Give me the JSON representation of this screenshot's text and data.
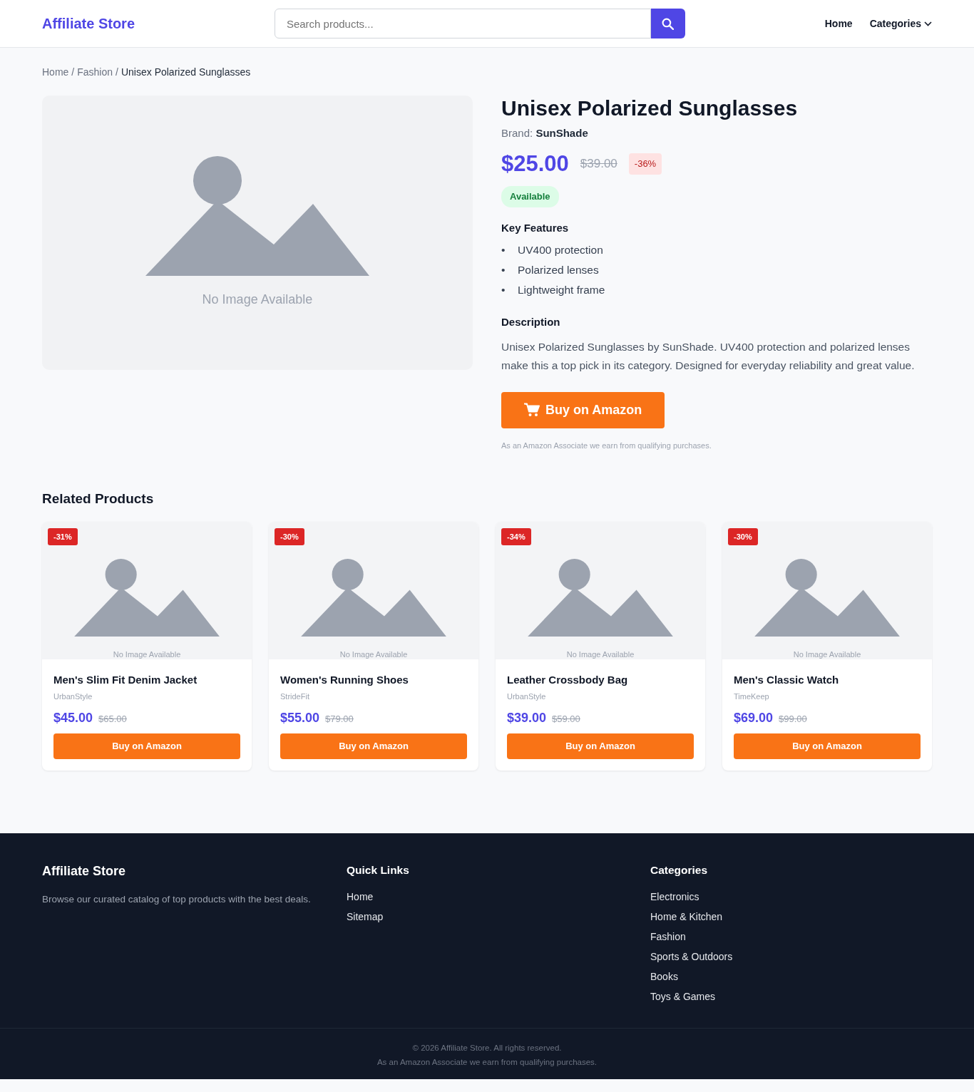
{
  "header": {
    "brand": "Affiliate Store",
    "search": {
      "placeholder": "Search products..."
    },
    "nav": [
      {
        "label": "Home",
        "kind": "link"
      },
      {
        "label": "Categories",
        "kind": "dropdown"
      }
    ]
  },
  "breadcrumb": {
    "separator": "/",
    "items": [
      "Home",
      "Fashion",
      "Unisex Polarized Sunglasses"
    ]
  },
  "product": {
    "image_caption": "No Image Available",
    "title": "Unisex Polarized Sunglasses",
    "brand_line": "Brand: **SunShade**",
    "price": "$25.00",
    "old_price": "$39.00",
    "discount": "-36%",
    "availability": "Available",
    "features_heading": "Key Features",
    "feature_bullet": "•",
    "features": [
      "UV400 protection",
      "Polarized lenses",
      "Lightweight frame"
    ],
    "description_heading": "Description",
    "description": "Unisex Polarized Sunglasses by SunShade. UV400 protection and polarized lenses make this a top pick in its category. Designed for everyday reliability and great value.",
    "buy_button": "Buy on Amazon",
    "disclosure": "As an Amazon Associate we earn from qualifying purchases."
  },
  "related": {
    "heading": "Related Products",
    "items": [
      {
        "discount": "-31%",
        "image_caption": "No Image Available",
        "name": "Men's Slim Fit Denim Jacket",
        "brand": "UrbanStyle",
        "price": "$45.00",
        "old_price": "$65.00",
        "button": "Buy on Amazon"
      },
      {
        "discount": "-30%",
        "image_caption": "No Image Available",
        "name": "Women's Running Shoes",
        "brand": "StrideFit",
        "price": "$55.00",
        "old_price": "$79.00",
        "button": "Buy on Amazon"
      },
      {
        "discount": "-34%",
        "image_caption": "No Image Available",
        "name": "Leather Crossbody Bag",
        "brand": "UrbanStyle",
        "price": "$39.00",
        "old_price": "$59.00",
        "button": "Buy on Amazon"
      },
      {
        "discount": "-30%",
        "image_caption": "No Image Available",
        "name": "Men's Classic Watch",
        "brand": "TimeKeep",
        "price": "$69.00",
        "old_price": "$99.00",
        "button": "Buy on Amazon"
      }
    ]
  },
  "footer": {
    "brand": "Affiliate Store",
    "tagline": "Browse our curated catalog of top products with the best deals.",
    "columns": [
      {
        "heading": "Quick Links",
        "links": [
          "Home",
          "Sitemap"
        ]
      },
      {
        "heading": "Categories",
        "links": [
          "Electronics",
          "Home & Kitchen",
          "Fashion",
          "Sports & Outdoors",
          "Books",
          "Toys & Games"
        ]
      }
    ],
    "copyright": "© 2026 Affiliate Store. All rights reserved.",
    "disclosure": "As an Amazon Associate we earn from qualifying purchases."
  }
}
